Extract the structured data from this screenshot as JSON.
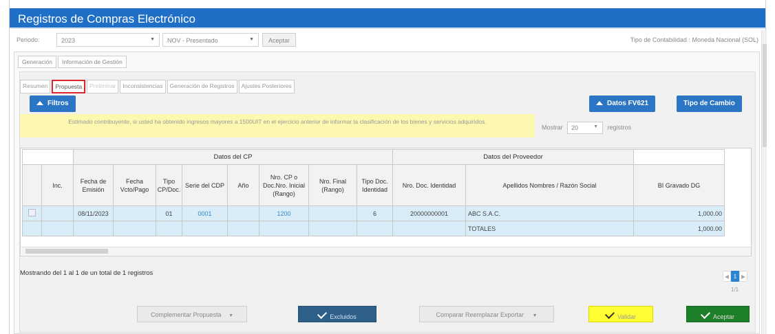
{
  "app": {
    "title": "Registros de Compras Electrónico"
  },
  "period": {
    "label": "Periodo:",
    "year": "2023",
    "month": "NOV - Presentado",
    "accept": "Aceptar",
    "tipo": "Tipo de Contabilidad : Moneda Nacional (SOL)"
  },
  "tabs_main": [
    "Generación",
    "Información de Gestión"
  ],
  "tabs_sub": [
    {
      "label": "Resumen",
      "state": "normal"
    },
    {
      "label": "Propuesta",
      "state": "active"
    },
    {
      "label": "Preliminar",
      "state": "disabled"
    },
    {
      "label": "Inconsistencias",
      "state": "normal"
    },
    {
      "label": "Generación de Registros",
      "state": "normal"
    },
    {
      "label": "Ajustes Posteriores",
      "state": "normal"
    }
  ],
  "buttons": {
    "filtros": "Filtros",
    "datos_fv621": "Datos FV621",
    "tipo_cambio": "Tipo de Cambio"
  },
  "notice": "Estimado contribuyente, si usted ha obtenido ingresos mayores a 1500UIT en el ejercicio anterior de informar la clasificación de los bienes y servicios adquiridos.",
  "mostrar": {
    "label": "Mostrar",
    "value": "20",
    "suffix": "registros"
  },
  "table": {
    "group_cp": "Datos del CP",
    "group_prov": "Datos del Proveedor",
    "headers": {
      "inc": "Inc.",
      "fecha_emision": "Fecha de Emisión",
      "fecha_vcto": "Fecha Vcto/Pago",
      "tipo": "Tipo CP/Doc.",
      "serie": "Serie del CDP",
      "anio": "Año",
      "nro_cp": "Nro. CP o Doc.Nro. Inicial (Rango)",
      "nro_final": "Nro. Final (Rango)",
      "tipo_doc": "Tipo Doc. Identidad",
      "nro_doc": "Nro. Doc. Identidad",
      "razon": "Apellidos Nombres / Razón Social",
      "bi": "BI Gravado DG"
    },
    "row": {
      "fecha_emision": "08/11/2023",
      "tipo": "01",
      "serie": "0001",
      "nro_cp": "1200",
      "tipo_doc": "6",
      "nro_doc": "20000000001",
      "razon": "ABC S.A.C.",
      "bi": "1,000.00"
    },
    "totals": {
      "label": "TOTALES",
      "bi": "1,000.00"
    }
  },
  "showing": "Mostrando del 1 al 1 de un total de 1 registros",
  "pager": {
    "page": "1",
    "count": "1/1"
  },
  "actions": {
    "complementar": "Complementar Propuesta",
    "excluidos": "Excluidos",
    "comparar": "Comparar Reemplazar Exportar",
    "validar": "Validar",
    "aceptar": "Aceptar"
  }
}
